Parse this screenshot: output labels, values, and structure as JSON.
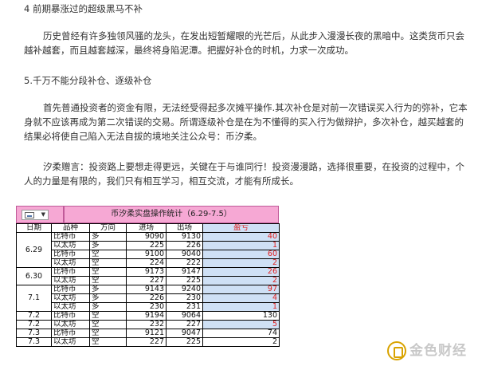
{
  "sections": [
    {
      "heading": "4 前期暴涨过的超级黑马不补",
      "paragraphs": [
        "历史曾经有许多独领风骚的龙头，在发出短暂耀眼的光芒后，从此步入漫漫长夜的黑暗中。这类货币只会越补越套，而且越套越深，最终将身陷泥潭。把握好补仓的时机，力求一次成功。"
      ]
    },
    {
      "heading": "5.千万不能分段补仓、逐级补仓",
      "paragraphs": [
        "首先普通投资者的资金有限，无法经受得起多次摊平操作.其次补仓是对前一次错误买入行为的弥补，它本身就不应该再成为第二次错误的交易。所谓逐级补仓是在为不懂得的买入行为做辩护，多次补仓，越买越套的结果必将使自己陷入无法自拔的境地关注公众号：币汐柔。",
        "汐柔赠言：投资路上要想走得更远，关键在于与谁同行！投资漫漫路，选择很重要，在投资的过程中，个人的力量是有限的，我们只有相互学习，相互交流，才能有所成长。"
      ]
    }
  ],
  "table": {
    "title": "币汐柔实盘操作统计（6.29-7.5）",
    "headers": [
      "日期",
      "品种",
      "方向",
      "进场",
      "出场",
      "盈亏"
    ],
    "rows": [
      {
        "date": "6.29",
        "coin": "比特币",
        "dir": "多",
        "in": "9090",
        "out": "9130",
        "pnl": "40",
        "red": true
      },
      {
        "date": "",
        "coin": "以太坊",
        "dir": "多",
        "in": "225",
        "out": "226",
        "pnl": "1",
        "red": true
      },
      {
        "date": "",
        "coin": "比特币",
        "dir": "空",
        "in": "9100",
        "out": "9040",
        "pnl": "60",
        "red": true
      },
      {
        "date": "",
        "coin": "以太坊",
        "dir": "空",
        "in": "224",
        "out": "222",
        "pnl": "2",
        "red": true
      },
      {
        "date": "6.30",
        "coin": "比特币",
        "dir": "空",
        "in": "9173",
        "out": "9147",
        "pnl": "26",
        "red": true
      },
      {
        "date": "",
        "coin": "以太坊",
        "dir": "空",
        "in": "227",
        "out": "225",
        "pnl": "2",
        "red": true
      },
      {
        "date": "7.1",
        "coin": "比特币",
        "dir": "多",
        "in": "9143",
        "out": "9240",
        "pnl": "97",
        "red": true
      },
      {
        "date": "",
        "coin": "以太坊",
        "dir": "多",
        "in": "226",
        "out": "230",
        "pnl": "4",
        "red": true
      },
      {
        "date": "",
        "coin": "以太坊",
        "dir": "多",
        "in": "230",
        "out": "231",
        "pnl": "1",
        "red": true
      },
      {
        "date": "7.2",
        "coin": "比特币",
        "dir": "空",
        "in": "9194",
        "out": "9064",
        "pnl": "130",
        "red": false
      },
      {
        "date": "7.2",
        "coin": "以太坊",
        "dir": "空",
        "in": "232",
        "out": "227",
        "pnl": "5",
        "red": true
      },
      {
        "date": "7.3",
        "coin": "比特币",
        "dir": "空",
        "in": "9121",
        "out": "9047",
        "pnl": "74",
        "red": false
      },
      {
        "date": "7.3",
        "coin": "以太坊",
        "dir": "空",
        "in": "227",
        "out": "225",
        "pnl": "2",
        "red": false
      }
    ]
  },
  "watermark": {
    "text": "金色财经"
  },
  "colors": {
    "title_bg": "#f6a8d4",
    "profit_text": "#e02020",
    "profit_bg": "#cfe0f5"
  },
  "icons": {
    "toolbar": "picture-dropdown-icon",
    "watermark": "jinse-logo-icon"
  }
}
